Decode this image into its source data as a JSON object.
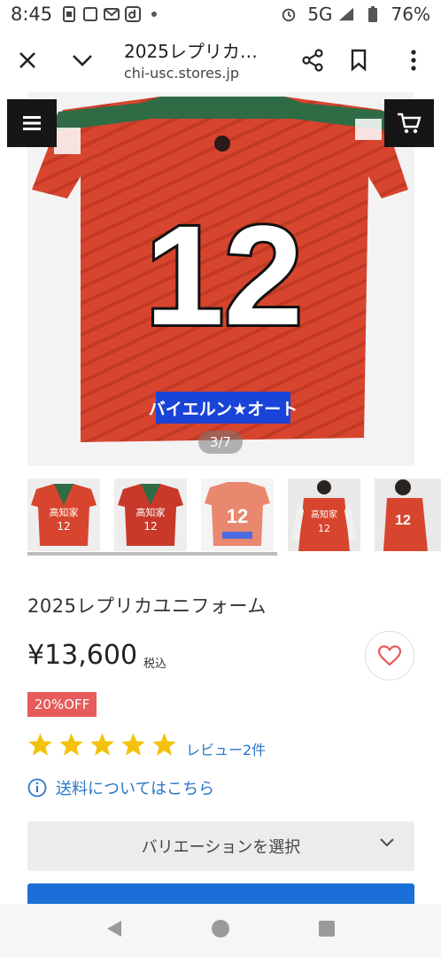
{
  "statusbar": {
    "time": "8:45",
    "network": "5G",
    "battery": "76%"
  },
  "toolbar": {
    "page_title": "2025レプリカ…",
    "url": "chi-usc.stores.jp"
  },
  "product": {
    "image_counter": "3/7",
    "title": "2025レプリカユニフォーム",
    "price": "¥13,600",
    "tax_label": "税込",
    "discount_badge": "20%OFF",
    "rating": 5,
    "review_link": "レビュー2件",
    "shipping_link": "送料についてはこちら",
    "variation_label": "バリエーションを選択"
  },
  "jersey": {
    "number": "12",
    "sponsor": "バイエルン★オート",
    "thumb_number": "12",
    "thumb_text": "高知家"
  },
  "colors": {
    "accent_blue": "#2b77c9",
    "badge_red": "#e85b5b",
    "jersey_red": "#d8452e"
  }
}
